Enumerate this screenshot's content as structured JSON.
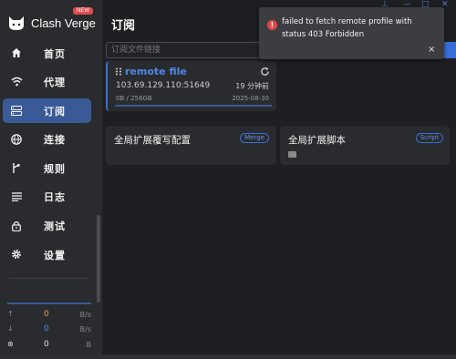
{
  "app": {
    "name": "Clash Verge",
    "badge": "NEW"
  },
  "nav": [
    {
      "label": "首页",
      "icon": "home-icon",
      "active": false
    },
    {
      "label": "代理",
      "icon": "wifi-icon",
      "active": false
    },
    {
      "label": "订阅",
      "icon": "storage-icon",
      "active": true
    },
    {
      "label": "连接",
      "icon": "globe-icon",
      "active": false
    },
    {
      "label": "规则",
      "icon": "fork-icon",
      "active": false
    },
    {
      "label": "日志",
      "icon": "list-icon",
      "active": false
    },
    {
      "label": "测试",
      "icon": "lock-icon",
      "active": false
    },
    {
      "label": "设置",
      "icon": "gear-icon",
      "active": false
    }
  ],
  "traffic": {
    "upload": {
      "value": "0",
      "unit": "B/s",
      "color": "#e8a33c"
    },
    "download": {
      "value": "0",
      "unit": "B/s",
      "color": "#4f86ec"
    },
    "memory": {
      "value": "0",
      "unit": "B"
    }
  },
  "page": {
    "title": "订阅",
    "url_placeholder": "订阅文件链接"
  },
  "profile": {
    "name": "remote file",
    "host": "103.69.129.110:51649",
    "updated": "19 分钟前",
    "usage": "0B / 256GB",
    "expire": "2025-08-30"
  },
  "extensions": {
    "merge": {
      "title": "全局扩展覆写配置",
      "tag": "Merge"
    },
    "script": {
      "title": "全局扩展脚本",
      "tag": "Script"
    }
  },
  "toast": {
    "message": "failed to fetch remote profile with status 403 Forbidden",
    "close": "×"
  },
  "colors": {
    "accent": "#3a6fd8",
    "active_nav": "#3a5a97",
    "error": "#e04848"
  }
}
